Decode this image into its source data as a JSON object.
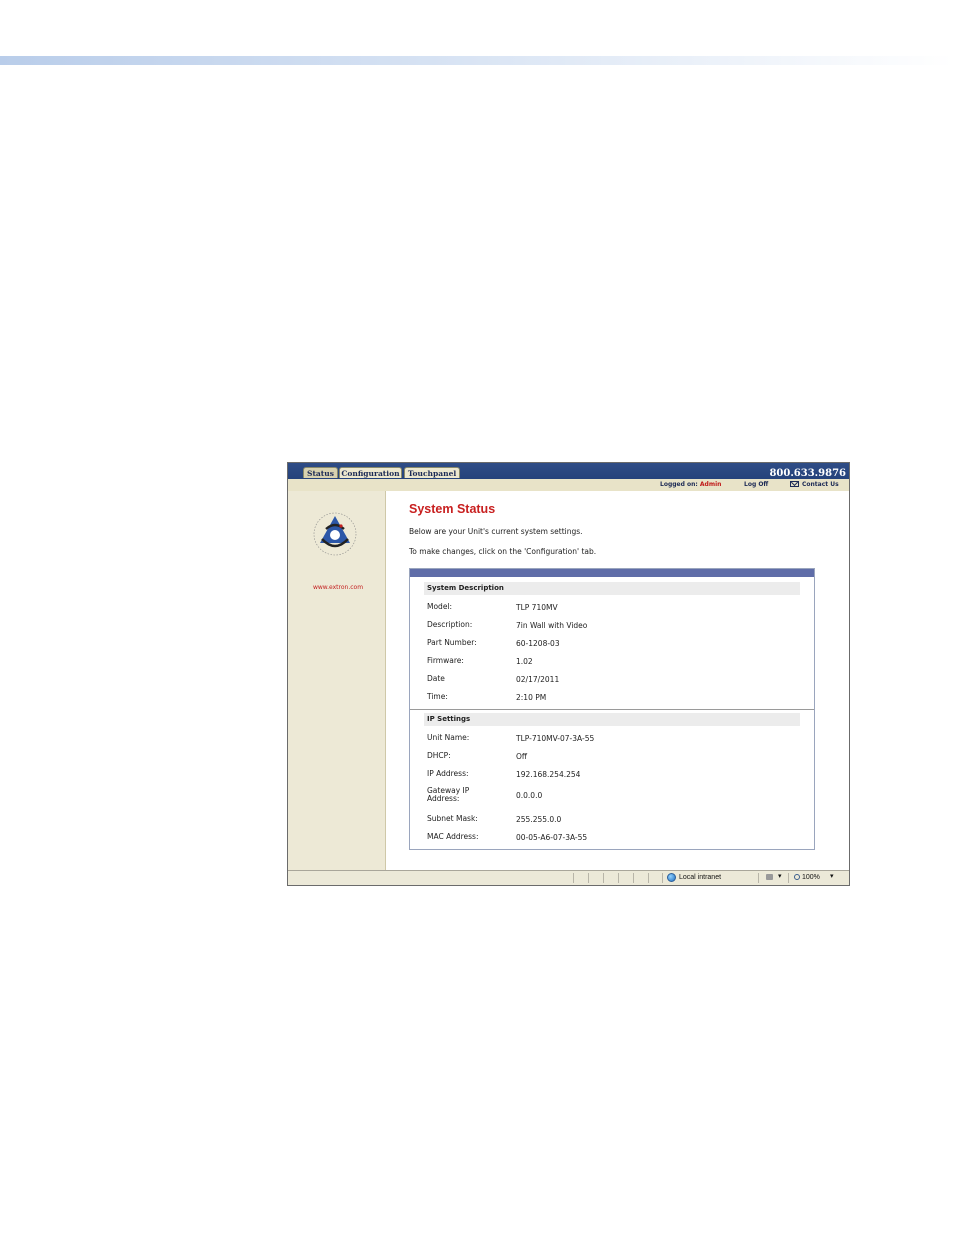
{
  "tabs": [
    {
      "label": "Status",
      "active": true
    },
    {
      "label": "Configuration",
      "active": false
    },
    {
      "label": "Touchpanel",
      "active": false
    }
  ],
  "header": {
    "phone": "800.633.9876",
    "logged_on_label": "Logged on:",
    "logged_on_user": "Admin",
    "log_off": "Log Off",
    "contact_us": "Contact Us"
  },
  "sidebar": {
    "url": "www.extron.com",
    "logo_icon": "extron-service-support-solutions-logo"
  },
  "main": {
    "title": "System Status",
    "intro_1": "Below are your Unit's current system settings.",
    "intro_2": "To make changes, click on the 'Configuration' tab."
  },
  "system_description": {
    "heading": "System Description",
    "rows": [
      {
        "label": "Model:",
        "value": "TLP 710MV"
      },
      {
        "label": "Description:",
        "value": "7in Wall with Video"
      },
      {
        "label": "Part Number:",
        "value": "60-1208-03"
      },
      {
        "label": "Firmware:",
        "value": "1.02"
      },
      {
        "label": "Date",
        "value": "02/17/2011"
      },
      {
        "label": "Time:",
        "value": "2:10 PM"
      }
    ]
  },
  "ip_settings": {
    "heading": "IP Settings",
    "rows": [
      {
        "label": "Unit Name:",
        "value": "TLP-710MV-07-3A-55"
      },
      {
        "label": "DHCP:",
        "value": "Off"
      },
      {
        "label": "IP Address:",
        "value": "192.168.254.254"
      },
      {
        "label": "Gateway IP Address:",
        "value": "0.0.0.0"
      },
      {
        "label": "Subnet Mask:",
        "value": "255.255.0.0"
      },
      {
        "label": "MAC Address:",
        "value": "00-05-A6-07-3A-55"
      }
    ]
  },
  "statusbar": {
    "zone": "Local intranet",
    "zoom": "100%"
  },
  "colors": {
    "title_red": "#c82020",
    "header_blue": "#1d3a73",
    "sidebar_beige": "#ede9d6",
    "panel_bar": "#5f6da8"
  }
}
